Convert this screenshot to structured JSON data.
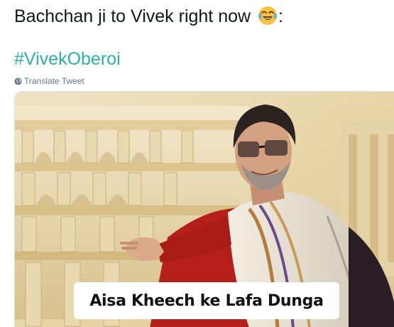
{
  "tweet": {
    "text": "Bachchan ji to Vivek right now",
    "emoji": "face-with-tears-of-joy",
    "text_suffix": ":",
    "hashtag": "#VivekOberoi",
    "translate_label": "Translate Tweet"
  },
  "media": {
    "caption": "Aisa Kheech ke Lafa Dunga"
  },
  "colors": {
    "hashtag": "#2bb3a0",
    "text": "#14171a",
    "muted": "#657786"
  }
}
